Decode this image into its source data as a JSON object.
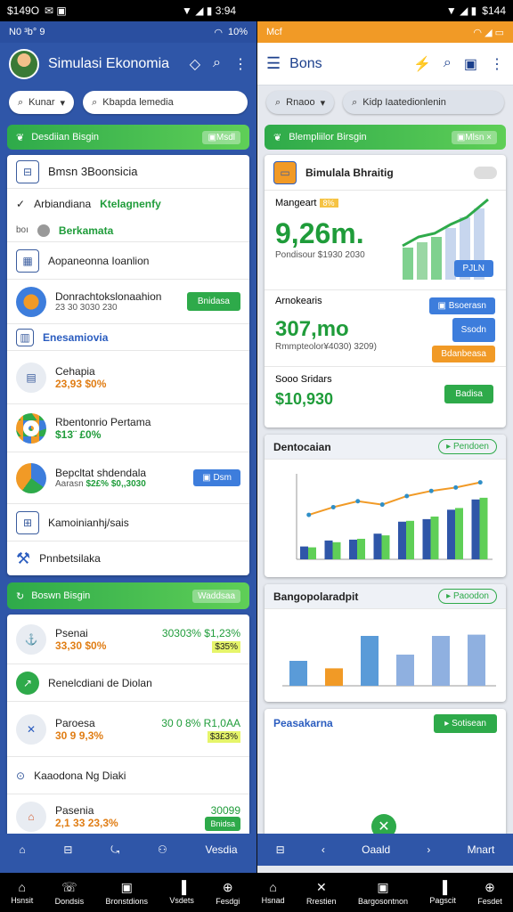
{
  "status_left": {
    "time": "$149O",
    "icons": "✉ ▣"
  },
  "status_right": {
    "time": "3:94"
  },
  "status_far": {
    "time": "$144"
  },
  "left": {
    "sub": {
      "left": "N0 ³b° 9",
      "right": "10%"
    },
    "title": "Simulasi Ekonomia",
    "chip_select": "Kunar",
    "chip_search": "Kbapda lemedia",
    "banner": {
      "text": "Desdiian Bisgin",
      "badge": "▣Msdl"
    },
    "rows": [
      {
        "label": "Bmsn 3Boonsicia"
      },
      {
        "label": "Arbiandiana",
        "green": "Ktelagnenfy"
      },
      {
        "prefix": "boı",
        "green": "Berkamata"
      },
      {
        "label": "Aopaneonna  Ioanlion"
      },
      {
        "label": "Donrachtokslonaahion",
        "sub": "23 30 3030 230",
        "btn": "Bnidasa"
      },
      {
        "label": "Enesamiovia"
      },
      {
        "label": "Cehapia",
        "orange": "23,93 $0%"
      },
      {
        "label": "Rbentonrio Pertama",
        "green": "$13¨ £0%"
      },
      {
        "label": "Bepcltat shdendala",
        "sub": "Aarasn",
        "green": "$2£% $0,,3030",
        "btn": "▣ Dsm"
      },
      {
        "label": "Kamoinianhj/sais"
      },
      {
        "label": "Pnnbetsilaka"
      }
    ],
    "banner2": {
      "text": "Boswn Bisgin",
      "badge": "Waddsaa"
    },
    "rows2": [
      {
        "label": "Psenai",
        "orange": "33,30 $0%",
        "green": "30303% $1,23%",
        "chip": "$35%"
      },
      {
        "label": "Renelcdiani de Diolan"
      },
      {
        "label": "Paroesa",
        "orange": "30 9 9,3%",
        "green": "30 0 8% R1,0AA",
        "chip": "$3£3%"
      },
      {
        "label": "Kaaodona Ng Diaki"
      },
      {
        "label": "Pasenia",
        "orange": "2,1 33 23,3%",
        "green": "30099",
        "chip": "Bnidsa"
      }
    ],
    "nav": {
      "label": "Vesdia"
    }
  },
  "right": {
    "sub": {
      "left": "Mcf"
    },
    "title": "Bons",
    "chip_select": "Rnaoo",
    "chip_search": "Kidp     Iaatedionlenin",
    "banner": {
      "text": "Blempliilor Birsgin",
      "badge": "▣Mlsn ×"
    },
    "sim": {
      "title": "Bimulala Bhraitig",
      "label": "Mangeart",
      "tag": "8%",
      "big": "9,26m.",
      "meta": "Pondisour $1930  2030",
      "btn": "PJLN"
    },
    "arm": {
      "label": "Arnokearis",
      "big": "307,mo",
      "meta": "Rmmpteolor¥4030) 3209)",
      "b1": "▣ Bsoerasn",
      "b2": "Ssodn",
      "b3": "Bdanbeasa"
    },
    "scs": {
      "label": "Sooo Sridars",
      "big": "$10,930",
      "btn": "Badisa"
    },
    "chart1": {
      "title": "Dentocaian",
      "pill": "▸ Pendoen"
    },
    "chart2": {
      "title": "Bangopolaradpit",
      "pill": "▸ Paoodon"
    },
    "empty": {
      "title": "Peasakarna",
      "pill": "▸ Sotisean"
    },
    "nav": {
      "mid": "Oaald",
      "right": "Mnart"
    }
  },
  "chart_data": [
    {
      "type": "bar",
      "title": "Dentocaian",
      "series": [
        {
          "values": [
            15,
            22,
            23,
            30,
            44,
            47,
            58,
            70
          ]
        },
        {
          "values": [
            14,
            20,
            24,
            28,
            45,
            50,
            60,
            72
          ]
        }
      ],
      "line": [
        52,
        61,
        68,
        64,
        74,
        80,
        84,
        90
      ]
    },
    {
      "type": "bar",
      "title": "Bangopolaradpit",
      "series": [
        {
          "values": [
            40,
            28,
            80
          ]
        },
        {
          "values": [
            50,
            80,
            82
          ]
        }
      ]
    }
  ],
  "sysnav": [
    "Hsnsit",
    "Dondsis",
    "Bronstdions",
    "Vsdets",
    "Fesdgi",
    "Hsnad",
    "Rrestien",
    "Bargosontnon",
    "Pagscit",
    "Fesdet"
  ]
}
